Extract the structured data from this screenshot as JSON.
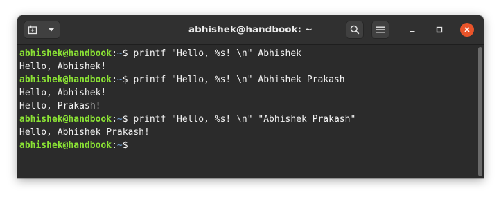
{
  "window": {
    "title": "abhishek@handbook: ~"
  },
  "titlebar": {
    "new_tab_icon": "new-tab-icon",
    "menu_icon": "chevron-down-icon",
    "search_icon": "search-icon",
    "hamburger_icon": "hamburger-icon",
    "minimize_icon": "minimize-icon",
    "maximize_icon": "maximize-icon",
    "close_icon": "close-icon"
  },
  "prompt": {
    "user_host": "abhishek@handbook",
    "separator": ":",
    "path": "~",
    "symbol": "$ "
  },
  "terminal": {
    "lines": [
      {
        "type": "command",
        "text": "printf \"Hello, %s! \\n\" Abhishek"
      },
      {
        "type": "output",
        "text": "Hello, Abhishek!"
      },
      {
        "type": "command",
        "text": "printf \"Hello, %s! \\n\" Abhishek Prakash"
      },
      {
        "type": "output",
        "text": "Hello, Abhishek!"
      },
      {
        "type": "output",
        "text": "Hello, Prakash!"
      },
      {
        "type": "command",
        "text": "printf \"Hello, %s! \\n\" \"Abhishek Prakash\""
      },
      {
        "type": "output",
        "text": "Hello, Abhishek Prakash!"
      },
      {
        "type": "command",
        "text": ""
      }
    ]
  },
  "colors": {
    "user_host": "#8ae234",
    "path": "#739fcf",
    "text": "#f2f2f2",
    "background": "#2b2b2b",
    "close_button": "#e9542a"
  }
}
